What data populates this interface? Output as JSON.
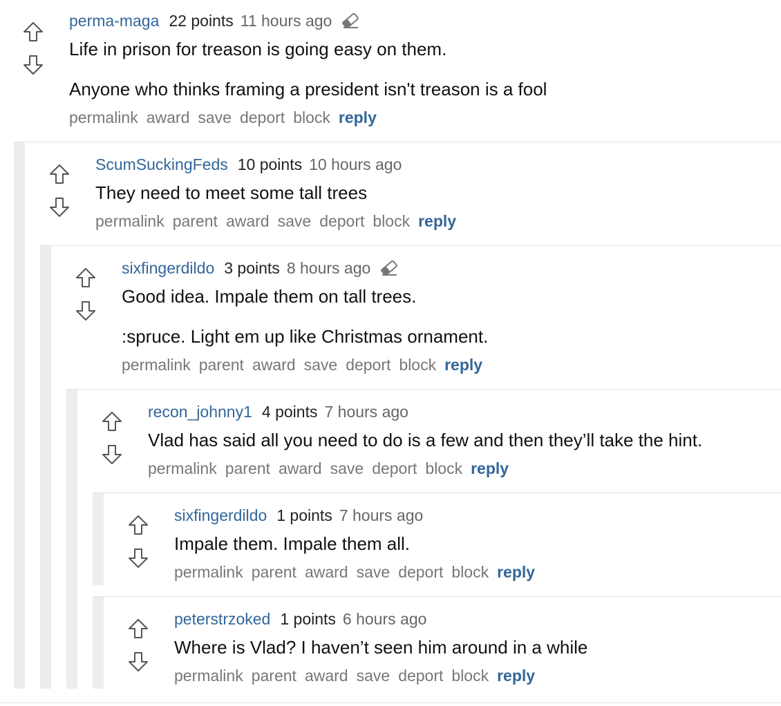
{
  "comments": [
    {
      "author": "perma-maga",
      "points": "22 points",
      "time": "11 hours ago",
      "paragraphs": [
        "Life in prison for treason is going easy on them.",
        "Anyone who thinks framing a president isn't treason is a fool"
      ],
      "actions": [
        "permalink",
        "award",
        "save",
        "deport",
        "block"
      ],
      "reply": "reply"
    },
    {
      "author": "ScumSuckingFeds",
      "points": "10 points",
      "time": "10 hours ago",
      "paragraphs": [
        "They need to meet some tall trees"
      ],
      "actions": [
        "permalink",
        "parent",
        "award",
        "save",
        "deport",
        "block"
      ],
      "reply": "reply"
    },
    {
      "author": "sixfingerdildo",
      "points": "3 points",
      "time": "8 hours ago",
      "paragraphs": [
        "Good idea. Impale them on tall trees.",
        ":spruce. Light em up like Christmas ornament."
      ],
      "actions": [
        "permalink",
        "parent",
        "award",
        "save",
        "deport",
        "block"
      ],
      "reply": "reply"
    },
    {
      "author": "recon_johnny1",
      "points": "4 points",
      "time": "7 hours ago",
      "paragraphs": [
        "Vlad has said all you need to do is a few and then they’ll take the hint."
      ],
      "actions": [
        "permalink",
        "parent",
        "award",
        "save",
        "deport",
        "block"
      ],
      "reply": "reply"
    },
    {
      "author": "sixfingerdildo",
      "points": "1 points",
      "time": "7 hours ago",
      "paragraphs": [
        "Impale them. Impale them all."
      ],
      "actions": [
        "permalink",
        "parent",
        "award",
        "save",
        "deport",
        "block"
      ],
      "reply": "reply"
    },
    {
      "author": "peterstrzoked",
      "points": "1 points",
      "time": "6 hours ago",
      "paragraphs": [
        "Where is Vlad? I haven’t seen him around in a while"
      ],
      "actions": [
        "permalink",
        "parent",
        "award",
        "save",
        "deport",
        "block"
      ],
      "reply": "reply"
    }
  ],
  "icons": {
    "upvote": "arrow-up-outline-icon",
    "downvote": "arrow-down-outline-icon",
    "edited": "eraser-icon"
  },
  "colors": {
    "author": "#336699",
    "reply": "#336699",
    "muted": "#777777",
    "thread_bar": "#ededed"
  }
}
